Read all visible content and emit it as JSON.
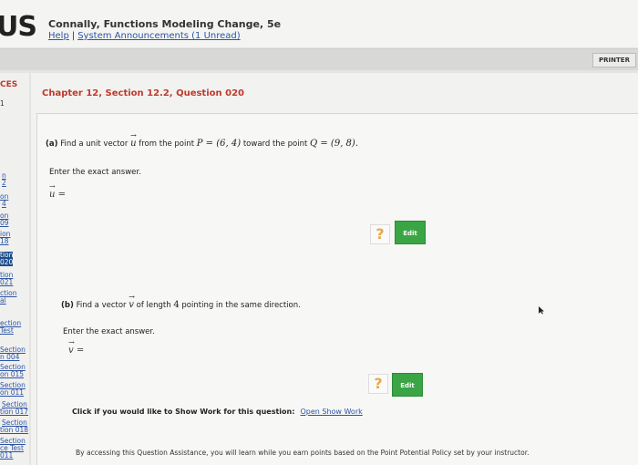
{
  "header": {
    "logo": "US",
    "course_title": "Connally, Functions Modeling Change, 5e",
    "help_link": "Help",
    "separator": "|",
    "announcements_link": "System Announcements (1 Unread)"
  },
  "toolbar": {
    "printer_label": "PRINTER"
  },
  "sidebar": {
    "title": "CES",
    "items": [
      {
        "label": "1"
      },
      {
        "label": "n"
      },
      {
        "label": "2"
      },
      {
        "label": "on"
      },
      {
        "label": "4"
      },
      {
        "label": "on"
      },
      {
        "label": "09"
      },
      {
        "label": "ion"
      },
      {
        "label": "18"
      },
      {
        "label": "tion"
      },
      {
        "label": "020"
      },
      {
        "label": "tion"
      },
      {
        "label": "021"
      },
      {
        "label": "ction"
      },
      {
        "label": "al"
      },
      {
        "label": "ection"
      },
      {
        "label": "Test"
      },
      {
        "label": "Section"
      },
      {
        "label": "n 004"
      },
      {
        "label": "Section"
      },
      {
        "label": "on 015"
      },
      {
        "label": "Section"
      },
      {
        "label": "on 011"
      },
      {
        "label": "Section"
      },
      {
        "label": "tion 017"
      },
      {
        "label": "Section"
      },
      {
        "label": "tion 018"
      },
      {
        "label": "Section"
      },
      {
        "label": "ce Test"
      },
      {
        "label": "011"
      }
    ]
  },
  "main": {
    "chapter_title": "Chapter 12, Section 12.2, Question 020",
    "part_a": {
      "label": "(a)",
      "prompt_1": "Find a unit vector",
      "vector": "u",
      "prompt_2": "from the point",
      "point_p": "P = (6, 4)",
      "prompt_3": "toward the point",
      "point_q": "Q = (9, 8).",
      "instruction": "Enter the exact answer.",
      "answer_var": "u",
      "equals": "="
    },
    "part_b": {
      "label": "(b)",
      "prompt_1": "Find a vector",
      "vector": "v",
      "prompt_2": "of length",
      "length": "4",
      "prompt_3": "pointing in the same direction.",
      "instruction": "Enter the exact answer.",
      "answer_var": "v",
      "equals": "="
    },
    "help_icon": "?",
    "edit_label": "Edit",
    "show_work": {
      "prompt": "Click if you would like to Show Work for this question:",
      "link": "Open Show Work"
    },
    "disclaimer": "By accessing this Question Assistance, you will learn while you earn points based on the Point Potential Policy set by your instructor."
  },
  "colors": {
    "accent_red": "#c0392b",
    "link_blue": "#2c55a8",
    "edit_green": "#3aa544",
    "help_orange": "#e6a94a"
  }
}
